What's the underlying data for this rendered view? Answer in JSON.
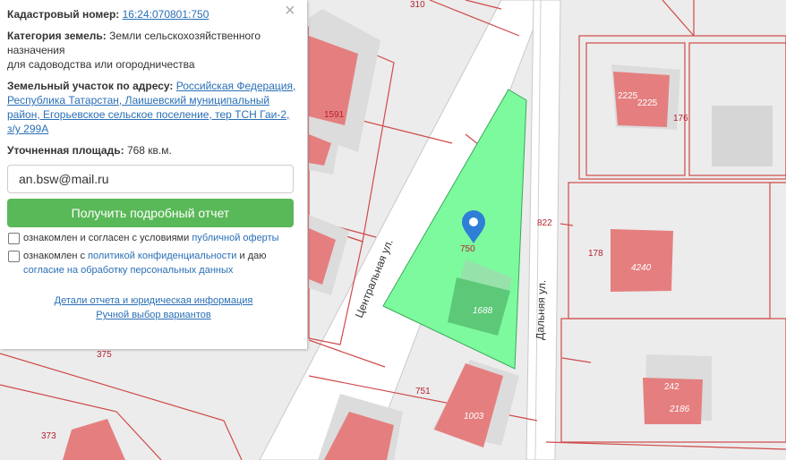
{
  "panel": {
    "cadastral_label": "Кадастровый номер:",
    "cadastral_value": "16:24:070801:750",
    "category_label": "Категория земель:",
    "category_value": "Земли сельскохозяйственного назначения",
    "category_use": "для садоводства или огородничества",
    "address_label": "Земельный участок по адресу:",
    "address_value": "Российская Федерация, Республика Татарстан, Лаишевский муниципальный район, Егорьевское сельское поселение, тер ТСН Гаи-2, з/у 299А",
    "area_label": "Уточненная площадь:",
    "area_value": "768 кв.м.",
    "email_value": "an.bsw@mail.ru",
    "report_button": "Получить подробный отчет",
    "consent1_text": "ознакомлен и согласен с условиями",
    "consent1_link": "публичной оферты",
    "consent2_text": "ознакомлен с",
    "consent2_link": "политикой конфиденциальности",
    "consent2_mid": "и даю",
    "consent2_link2": "согласие на обработку персональных данных",
    "details_link": "Детали отчета и юридическая информация",
    "manual_link": "Ручной выбор вариантов",
    "close_glyph": "×"
  },
  "map": {
    "selected_plot": "750",
    "building_selected": "1688",
    "streets": {
      "central": "Центральная ул.",
      "dalnyaya": "Дальняя ул."
    },
    "plot_labels": [
      "310",
      "1591",
      "822",
      "178",
      "751",
      "375",
      "373",
      "176"
    ],
    "building_labels": [
      "2225",
      "2225",
      "4240",
      "242",
      "2186",
      "1003"
    ],
    "colors": {
      "selected_fill": "#7dfa9e",
      "building": "#e57f7f",
      "boundary": "#d04a4a",
      "road": "#ffffff",
      "marker": "#2f7fd6"
    },
    "marker_icon": "map-pin-icon"
  }
}
